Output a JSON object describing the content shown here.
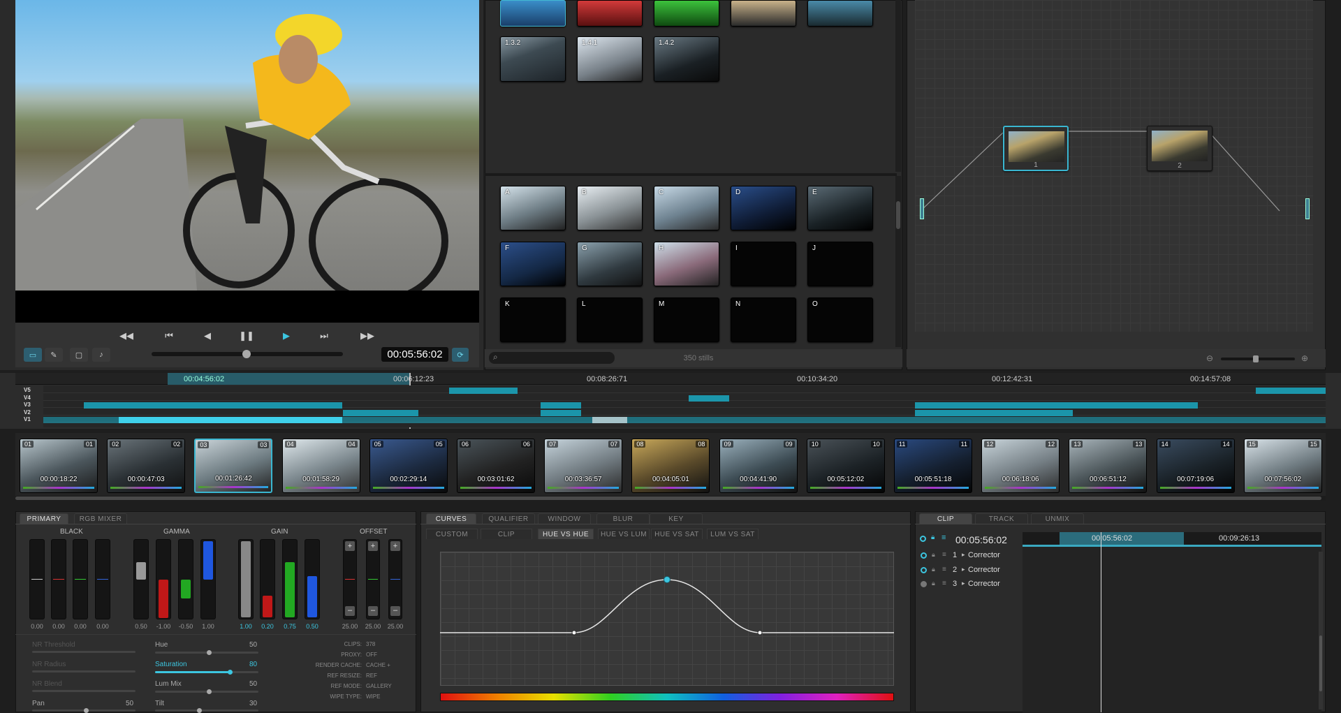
{
  "viewer": {
    "timecode": "00:05:56:02"
  },
  "gallery": {
    "top_stills": [
      "",
      "",
      "",
      "",
      ""
    ],
    "mid_stills": [
      "1.3.2",
      "1.4.1",
      "1.4.2"
    ],
    "memories": [
      "A",
      "B",
      "C",
      "D",
      "E",
      "F",
      "G",
      "H",
      "I",
      "J",
      "K",
      "L",
      "M",
      "N",
      "O"
    ],
    "stills_count": "350 stills"
  },
  "nodes": [
    {
      "label": "1"
    },
    {
      "label": "2"
    }
  ],
  "timeline": {
    "ruler": [
      "00:04:56:02",
      "00:06:12:23",
      "00:08:26:71",
      "00:10:34:20",
      "00:12:42:31",
      "00:14:57:08"
    ],
    "tracks": [
      "V5",
      "V4",
      "V3",
      "V2",
      "V1"
    ]
  },
  "clips": [
    {
      "num": "01",
      "tc": "00:00:18:22"
    },
    {
      "num": "02",
      "tc": "00:00:47:03"
    },
    {
      "num": "03",
      "tc": "00:01:26:42"
    },
    {
      "num": "04",
      "tc": "00:01:58:29"
    },
    {
      "num": "05",
      "tc": "00:02:29:14"
    },
    {
      "num": "06",
      "tc": "00:03:01:62"
    },
    {
      "num": "07",
      "tc": "00:03:36:57"
    },
    {
      "num": "08",
      "tc": "00:04:05:01"
    },
    {
      "num": "09",
      "tc": "00:04:41:90"
    },
    {
      "num": "10",
      "tc": "00:05:12:02"
    },
    {
      "num": "11",
      "tc": "00:05:51:18"
    },
    {
      "num": "12",
      "tc": "00:06:18:06"
    },
    {
      "num": "13",
      "tc": "00:06:51:12"
    },
    {
      "num": "14",
      "tc": "00:07:19:06"
    },
    {
      "num": "15",
      "tc": "00:07:56:02"
    }
  ],
  "primary": {
    "tabs": [
      "PRIMARY",
      "RGB MIXER"
    ],
    "groups": [
      "BLACK",
      "GAMMA",
      "GAIN",
      "OFFSET"
    ],
    "black_vals": [
      "0.00",
      "0.00",
      "0.00",
      "0.00"
    ],
    "gamma_vals": [
      "0.50",
      "-1.00",
      "-0.50",
      "1.00"
    ],
    "gain_vals": [
      "1.00",
      "0.20",
      "0.75",
      "0.50"
    ],
    "offset_vals": [
      "25.00",
      "25.00",
      "25.00"
    ],
    "left_sliders": [
      {
        "label": "NR Threshold",
        "value": ""
      },
      {
        "label": "NR Radius",
        "value": ""
      },
      {
        "label": "NR Blend",
        "value": ""
      },
      {
        "label": "Pan",
        "value": "50"
      }
    ],
    "mid_sliders": [
      {
        "label": "Hue",
        "value": "50"
      },
      {
        "label": "Saturation",
        "value": "80"
      },
      {
        "label": "Lum Mix",
        "value": "50"
      },
      {
        "label": "Tilt",
        "value": "30"
      }
    ],
    "meta": [
      {
        "k": "CLIPS:",
        "v": "378"
      },
      {
        "k": "PROXY:",
        "v": "OFF"
      },
      {
        "k": "RENDER CACHE:",
        "v": "CACHE +"
      },
      {
        "k": "REF RESIZE:",
        "v": "REF"
      },
      {
        "k": "REF MODE:",
        "v": "GALLERY"
      },
      {
        "k": "WIPE TYPE:",
        "v": "WIPE"
      }
    ]
  },
  "curves": {
    "tabs": [
      "CURVES",
      "QUALIFIER",
      "WINDOW",
      "BLUR",
      "KEY"
    ],
    "subtabs": [
      "CUSTOM",
      "CLIP",
      "HUE VS HUE",
      "HUE VS LUM",
      "HUE VS SAT",
      "LUM VS SAT"
    ]
  },
  "keyframes": {
    "tabs": [
      "CLIP",
      "TRACK",
      "UNMIX"
    ],
    "timecode": "00:05:56:02",
    "ruler": [
      "00:05:56:02",
      "00:09:26:13"
    ],
    "rows": [
      {
        "num": "1",
        "label": "Corrector"
      },
      {
        "num": "2",
        "label": "Corrector"
      },
      {
        "num": "3",
        "label": "Corrector"
      }
    ]
  }
}
